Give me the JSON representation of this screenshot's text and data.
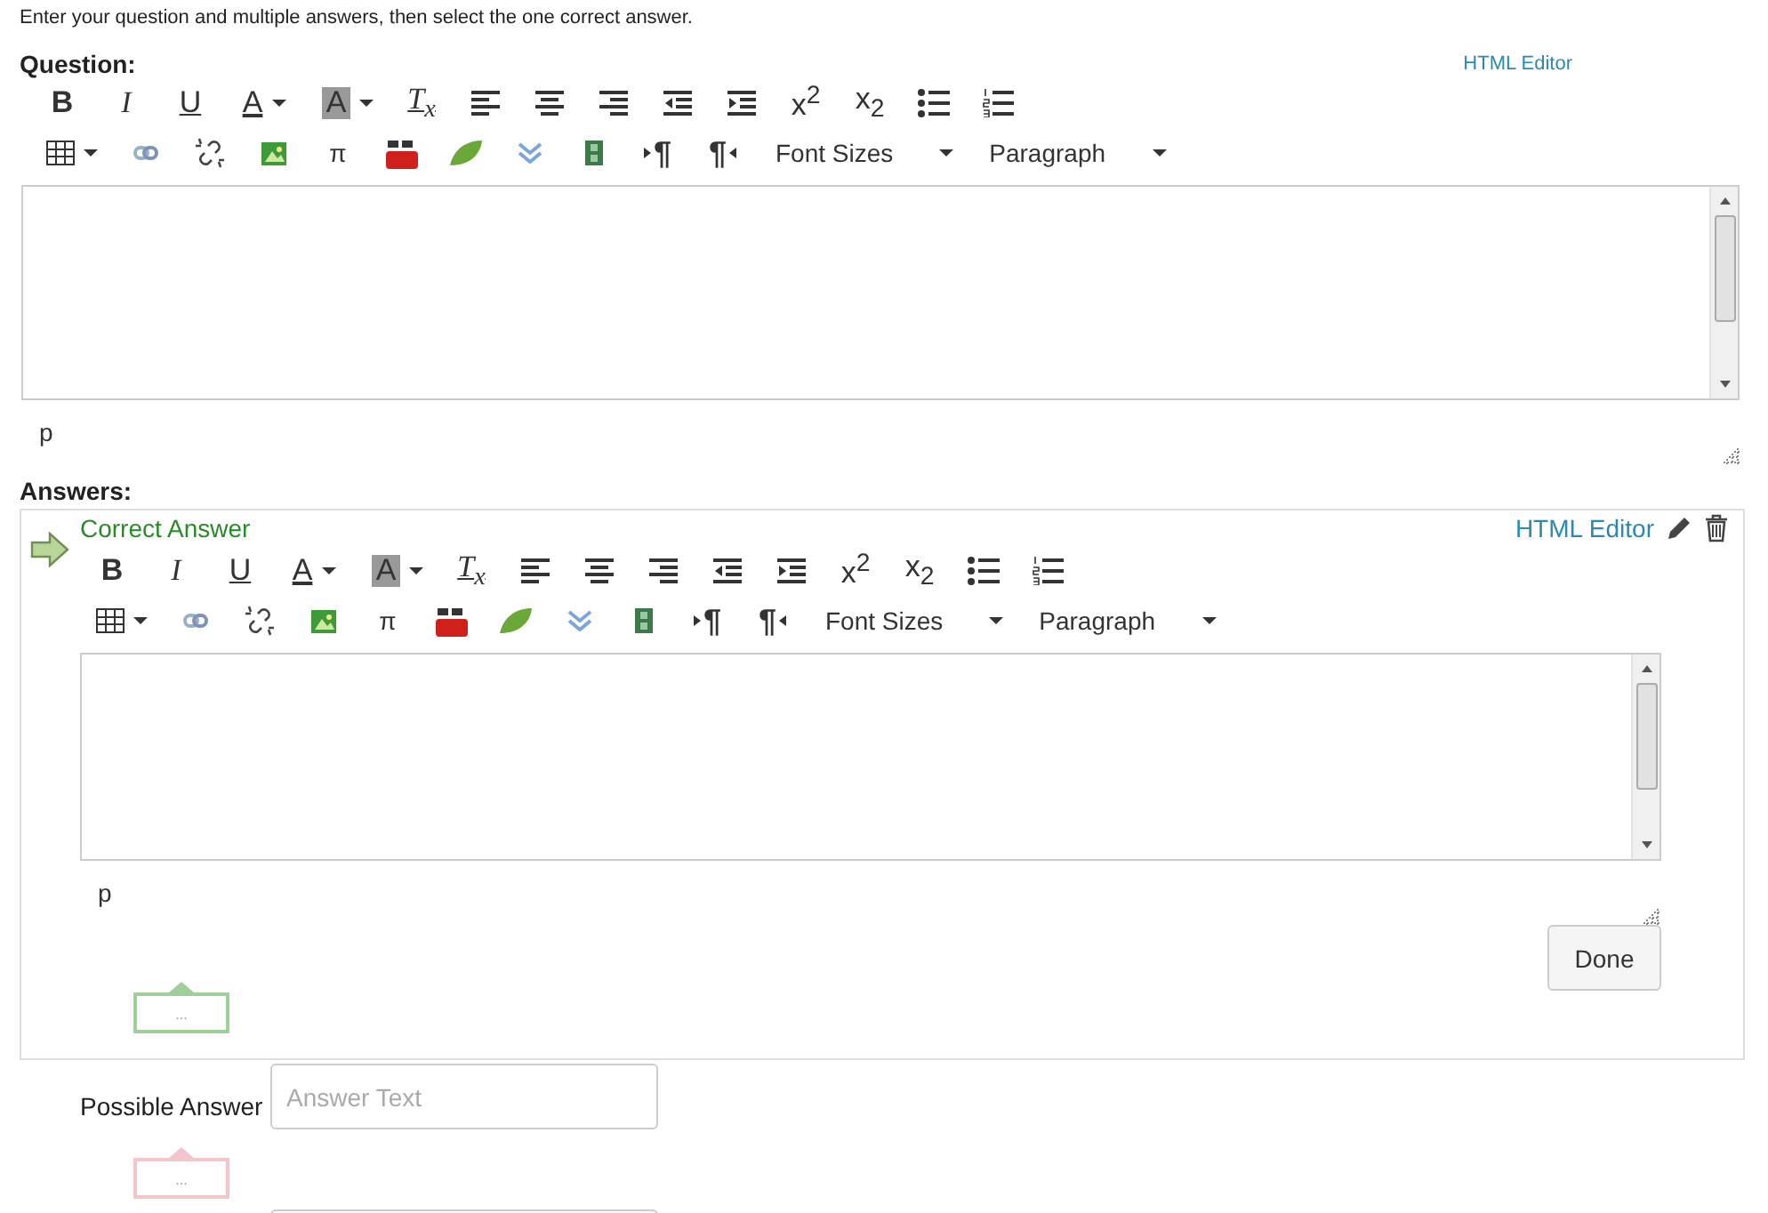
{
  "instructions": "Enter your question and multiple answers, then select the one correct answer.",
  "sections": [
    {
      "kind": "question",
      "label": "Question:",
      "html_editor_link": "HTML Editor",
      "editor": {
        "path": "p",
        "toolbar": [
          [
            {
              "kind": "bold",
              "label": "B"
            },
            {
              "kind": "italic",
              "label": "I"
            },
            {
              "kind": "underline",
              "label": "U"
            },
            {
              "kind": "forecolor",
              "label": "A"
            },
            {
              "kind": "backcolor",
              "label": "A"
            },
            {
              "kind": "removeformat",
              "label": "T$_{x}$"
            },
            {
              "kind": "alignleft"
            },
            {
              "kind": "aligncenter"
            },
            {
              "kind": "alignright"
            },
            {
              "kind": "outdent"
            },
            {
              "kind": "indent"
            },
            {
              "kind": "superscript",
              "label": "x$^{2}$"
            },
            {
              "kind": "subscript",
              "label": "x$_{2}$"
            },
            {
              "kind": "bullist"
            },
            {
              "kind": "numlist"
            }
          ],
          [
            {
              "kind": "table"
            },
            {
              "kind": "link"
            },
            {
              "kind": "unlink"
            },
            {
              "kind": "image"
            },
            {
              "kind": "symbol",
              "label": "π"
            },
            {
              "kind": "youtube"
            },
            {
              "kind": "leaf"
            },
            {
              "kind": "chevron"
            },
            {
              "kind": "film"
            },
            {
              "kind": "ltr",
              "label": "¶"
            },
            {
              "kind": "rtl",
              "label": "¶"
            },
            {
              "kind": "select",
              "label": "Font Sizes"
            },
            {
              "kind": "select",
              "label": "Paragraph"
            }
          ]
        ]
      }
    },
    {
      "kind": "answer",
      "label": "Answers:",
      "title": "Correct Answer",
      "html_editor_link": "HTML Editor",
      "done_button": "Done",
      "tag": {
        "color": "#9fcf9a",
        "text": "..."
      },
      "editor": {
        "path": "p",
        "toolbar": [
          [
            {
              "kind": "bold",
              "label": "B"
            },
            {
              "kind": "italic",
              "label": "I"
            },
            {
              "kind": "underline",
              "label": "U"
            },
            {
              "kind": "forecolor",
              "label": "A"
            },
            {
              "kind": "backcolor",
              "label": "A"
            },
            {
              "kind": "removeformat",
              "label": "T$_{x}$"
            },
            {
              "kind": "alignleft"
            },
            {
              "kind": "aligncenter"
            },
            {
              "kind": "alignright"
            },
            {
              "kind": "outdent"
            },
            {
              "kind": "indent"
            },
            {
              "kind": "superscript",
              "label": "x$^{2}$"
            },
            {
              "kind": "subscript",
              "label": "x$_{2}$"
            },
            {
              "kind": "bullist"
            },
            {
              "kind": "numlist"
            }
          ],
          [
            {
              "kind": "table"
            },
            {
              "kind": "link"
            },
            {
              "kind": "unlink"
            },
            {
              "kind": "image"
            },
            {
              "kind": "symbol",
              "label": "π"
            },
            {
              "kind": "youtube"
            },
            {
              "kind": "leaf"
            },
            {
              "kind": "chevron"
            },
            {
              "kind": "film"
            },
            {
              "kind": "ltr",
              "label": "¶"
            },
            {
              "kind": "rtl",
              "label": "¶"
            },
            {
              "kind": "select",
              "label": "Font Sizes"
            },
            {
              "kind": "select",
              "label": "Paragraph"
            }
          ]
        ]
      }
    }
  ],
  "possible_answers": [
    {
      "kind": "field",
      "label": "Possible Answer",
      "placeholder": "Answer Text",
      "tag": {
        "color": "#f3c6cc",
        "text": "..."
      }
    },
    {
      "kind": "field"
    }
  ]
}
